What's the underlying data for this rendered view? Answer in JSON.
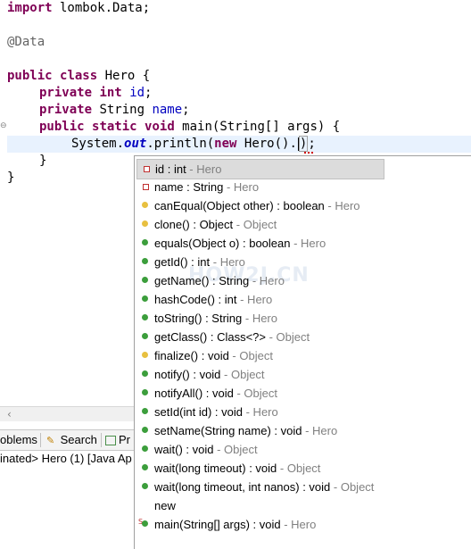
{
  "editor": {
    "lines": [
      {
        "kind": "import",
        "keyword": "import",
        "rest": " lombok.Data;"
      },
      {
        "kind": "annotation",
        "text": "@Data"
      },
      {
        "kind": "class",
        "kw1": "public",
        "kw2": "class",
        "rest": " Hero {"
      },
      {
        "kind": "field1",
        "kw1": "private",
        "kw2": "int",
        "field": "id",
        "end": ";"
      },
      {
        "kind": "field2",
        "kw1": "private",
        "type": " String ",
        "field": "name",
        "end": ";"
      },
      {
        "kind": "main",
        "kw1": "public",
        "kw2": "static",
        "kw3": "void",
        "rest": " main(String[] args) {"
      },
      {
        "kind": "current",
        "pre": "System.",
        "out": "out",
        "mid": ".println(",
        "kwnew": "new",
        "post": " Hero()",
        "dot": ".",
        "close": ")",
        "semi": ";"
      },
      {
        "kind": "close1",
        "text": "}"
      },
      {
        "kind": "close2",
        "text": "}"
      }
    ]
  },
  "views": {
    "tabs": [
      {
        "label": "oblems",
        "icon": "problems-icon"
      },
      {
        "label": "Search",
        "icon": "search-icon"
      },
      {
        "label": "Pr",
        "icon": "progress-icon"
      }
    ],
    "console_text": "inated> Hero (1) [Java Ap"
  },
  "watermark": "HOW2J.CN",
  "content_assist": {
    "proposals": [
      {
        "icon": "private-field-icon",
        "sig": "id : int",
        "decl": " - Hero",
        "selected": true
      },
      {
        "icon": "private-field-icon",
        "sig": "name : String",
        "decl": " - Hero"
      },
      {
        "icon": "protected-method-icon",
        "sig": "canEqual(Object other) : boolean",
        "decl": " - Hero"
      },
      {
        "icon": "protected-method-icon",
        "sig": "clone() : Object",
        "decl": " - Object"
      },
      {
        "icon": "public-method-icon",
        "sig": "equals(Object o) : boolean",
        "decl": " - Hero"
      },
      {
        "icon": "public-method-icon",
        "sig": "getId() : int",
        "decl": " - Hero"
      },
      {
        "icon": "public-method-icon",
        "sig": "getName() : String",
        "decl": " - Hero"
      },
      {
        "icon": "public-method-icon",
        "sig": "hashCode() : int",
        "decl": " - Hero"
      },
      {
        "icon": "public-method-icon",
        "sig": "toString() : String",
        "decl": " - Hero"
      },
      {
        "icon": "public-method-icon",
        "sig": "getClass() : Class<?>",
        "decl": " - Object"
      },
      {
        "icon": "protected-method-icon",
        "sig": "finalize() : void",
        "decl": " - Object"
      },
      {
        "icon": "public-method-icon",
        "sig": "notify() : void",
        "decl": " - Object"
      },
      {
        "icon": "public-method-icon",
        "sig": "notifyAll() : void",
        "decl": " - Object"
      },
      {
        "icon": "public-method-icon",
        "sig": "setId(int id) : void",
        "decl": " - Hero"
      },
      {
        "icon": "public-method-icon",
        "sig": "setName(String name) : void",
        "decl": " - Hero"
      },
      {
        "icon": "public-method-icon",
        "sig": "wait() : void",
        "decl": " - Object"
      },
      {
        "icon": "public-method-icon",
        "sig": "wait(long timeout) : void",
        "decl": " - Object"
      },
      {
        "icon": "public-method-icon",
        "sig": "wait(long timeout, int nanos) : void",
        "decl": " - Object"
      },
      {
        "icon": "template-icon",
        "sig": "new",
        "decl": ""
      },
      {
        "icon": "static-method-icon",
        "sig": "main(String[] args) : void",
        "decl": " - Hero"
      }
    ]
  },
  "colors": {
    "keyword": "#7f0055",
    "field": "#0000c0",
    "annotation": "#646464",
    "current_line": "#e8f2fe",
    "public_icon": "#3c9e3c",
    "protected_icon": "#e8c040",
    "private_icon": "#c03030"
  }
}
